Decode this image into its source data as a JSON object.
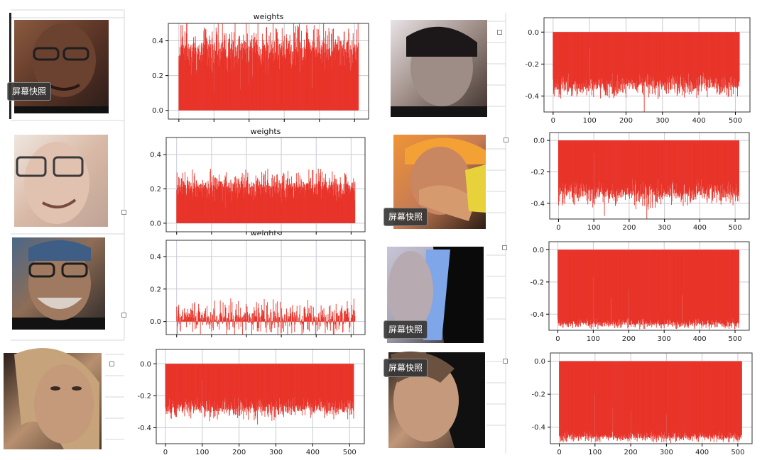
{
  "colors": {
    "bar": "#e8342a",
    "axis": "#000000",
    "grid": "#c9c9d6",
    "tick_text": "#222222"
  },
  "snapshot_label": "屏幕快照",
  "chart_data": [
    {
      "type": "bar",
      "title": "weights",
      "xlabel": "",
      "ylabel": "",
      "n": 512,
      "xlim": [
        -30,
        540
      ],
      "ylim": [
        -0.05,
        0.5
      ],
      "yticks": [
        0.0,
        0.2,
        0.4
      ],
      "xticks": [
        0,
        100,
        200,
        300,
        400,
        500
      ],
      "show_xtick_labels": false,
      "base": 0.36,
      "jitter": 0.13,
      "spikes": [
        [
          250,
          0.48
        ],
        [
          100,
          0.1
        ],
        [
          200,
          0.15
        ],
        [
          175,
          0.12
        ],
        [
          380,
          0.13
        ]
      ],
      "grid": true
    },
    {
      "type": "bar",
      "title": "",
      "xlabel": "",
      "ylabel": "",
      "n": 512,
      "xlim": [
        -25,
        540
      ],
      "ylim": [
        -0.5,
        0.09
      ],
      "yticks": [
        0.0,
        -0.2,
        -0.4
      ],
      "xticks": [
        0,
        100,
        200,
        300,
        400,
        500
      ],
      "show_xtick_labels": true,
      "base": -0.34,
      "jitter": 0.07,
      "spikes": [
        [
          100,
          -0.1
        ],
        [
          250,
          -0.5
        ],
        [
          200,
          -0.41
        ],
        [
          310,
          -0.38
        ]
      ],
      "grid": true
    },
    {
      "type": "bar",
      "title": "weights",
      "xlabel": "",
      "ylabel": "",
      "n": 512,
      "xlim": [
        -30,
        540
      ],
      "ylim": [
        -0.05,
        0.5
      ],
      "yticks": [
        0.0,
        0.2,
        0.4
      ],
      "xticks": [
        0,
        100,
        200,
        300,
        400,
        500
      ],
      "show_xtick_labels": false,
      "base": 0.22,
      "jitter": 0.08,
      "spikes": [
        [
          100,
          0.24
        ],
        [
          250,
          0.29
        ],
        [
          140,
          0.09
        ],
        [
          300,
          0.12
        ]
      ],
      "grid": true
    },
    {
      "type": "bar",
      "title": "",
      "xlabel": "",
      "ylabel": "",
      "n": 512,
      "xlim": [
        -25,
        540
      ],
      "ylim": [
        -0.5,
        0.05
      ],
      "yticks": [
        0.0,
        -0.2,
        -0.4
      ],
      "xticks": [
        0,
        100,
        200,
        300,
        400,
        500
      ],
      "show_xtick_labels": true,
      "base": -0.34,
      "jitter": 0.08,
      "spikes": [
        [
          100,
          -0.08
        ],
        [
          130,
          -0.48
        ],
        [
          250,
          -0.5
        ],
        [
          320,
          -0.41
        ]
      ],
      "grid": true
    },
    {
      "type": "bar",
      "title": "weights",
      "xlabel": "",
      "ylabel": "",
      "n": 512,
      "xlim": [
        -30,
        540
      ],
      "ylim": [
        -0.08,
        0.5
      ],
      "yticks": [
        0.0,
        0.2,
        0.4
      ],
      "xticks": [
        0,
        100,
        200,
        300,
        400,
        500
      ],
      "show_xtick_labels": false,
      "base": 0.02,
      "jitter": 0.1,
      "spikes": [
        [
          125,
          0.13
        ],
        [
          300,
          -0.07
        ],
        [
          260,
          0.12
        ],
        [
          100,
          -0.06
        ]
      ],
      "grid": true
    },
    {
      "type": "bar",
      "title": "",
      "xlabel": "",
      "ylabel": "",
      "n": 512,
      "xlim": [
        -25,
        540
      ],
      "ylim": [
        -0.5,
        0.05
      ],
      "yticks": [
        0.0,
        -0.2,
        -0.4
      ],
      "xticks": [
        0,
        100,
        200,
        300,
        400,
        500
      ],
      "show_xtick_labels": true,
      "base": -0.46,
      "jitter": 0.03,
      "spikes": [
        [
          100,
          -0.17
        ],
        [
          200,
          -0.25
        ],
        [
          150,
          -0.3
        ],
        [
          350,
          -0.28
        ]
      ],
      "grid": true
    },
    {
      "type": "bar",
      "title": "",
      "xlabel": "",
      "ylabel": "",
      "n": 512,
      "xlim": [
        -25,
        540
      ],
      "ylim": [
        -0.5,
        0.09
      ],
      "yticks": [
        0.0,
        -0.2,
        -0.4
      ],
      "xticks": [
        0,
        100,
        200,
        300,
        400,
        500
      ],
      "show_xtick_labels": true,
      "base": -0.28,
      "jitter": 0.06,
      "spikes": [
        [
          100,
          -0.1
        ],
        [
          250,
          -0.38
        ],
        [
          300,
          -0.34
        ],
        [
          120,
          -0.36
        ]
      ],
      "grid": true
    },
    {
      "type": "bar",
      "title": "",
      "xlabel": "",
      "ylabel": "",
      "n": 512,
      "xlim": [
        -25,
        540
      ],
      "ylim": [
        -0.5,
        0.05
      ],
      "yticks": [
        0.0,
        -0.2,
        -0.4
      ],
      "xticks": [
        0,
        100,
        200,
        300,
        400,
        500
      ],
      "show_xtick_labels": true,
      "base": -0.46,
      "jitter": 0.03,
      "spikes": [
        [
          100,
          -0.2
        ],
        [
          150,
          -0.28
        ],
        [
          200,
          -0.3
        ],
        [
          300,
          -0.32
        ]
      ],
      "grid": true
    }
  ]
}
